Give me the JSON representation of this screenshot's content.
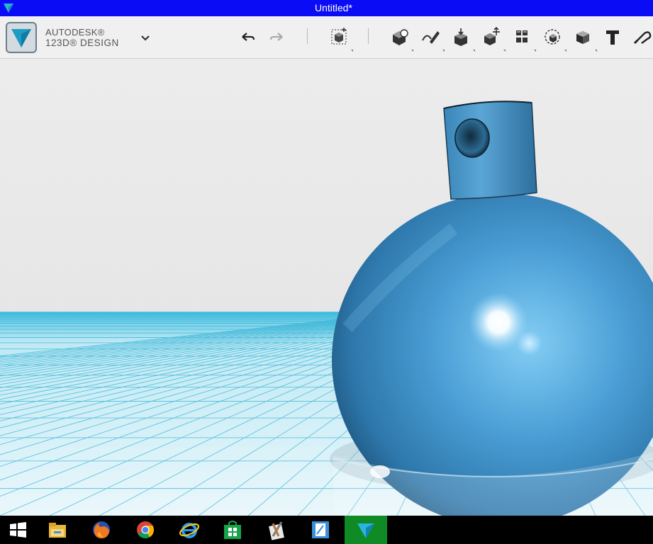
{
  "window": {
    "title": "Untitled*"
  },
  "app": {
    "brand_line1": "AUTODESK®",
    "brand_line2": "123D® DESIGN"
  },
  "toolbar": {
    "items": [
      {
        "icon": "undo-icon"
      },
      {
        "icon": "redo-icon"
      },
      {
        "icon": "primitives-icon"
      },
      {
        "icon": "sketch-icon"
      },
      {
        "icon": "construct-icon"
      },
      {
        "icon": "modify-icon"
      },
      {
        "icon": "pattern-icon"
      },
      {
        "icon": "group-icon"
      },
      {
        "icon": "combine-icon"
      },
      {
        "icon": "measure-icon"
      },
      {
        "icon": "text-icon"
      },
      {
        "icon": "snap-icon"
      }
    ]
  },
  "colors": {
    "titlebar": "#0a0cf5",
    "accent": "#1a9ba8",
    "model_blue": "#3e8fc7",
    "grid": "#39b4d6",
    "taskbar": "#000000",
    "active_task": "#0f8a24"
  },
  "taskbar": {
    "items": [
      {
        "icon": "windows-start-icon"
      },
      {
        "icon": "file-explorer-icon"
      },
      {
        "icon": "firefox-icon"
      },
      {
        "icon": "chrome-icon"
      },
      {
        "icon": "internet-explorer-icon"
      },
      {
        "icon": "windows-store-icon"
      },
      {
        "icon": "tools-app-icon"
      },
      {
        "icon": "notes-app-icon"
      },
      {
        "icon": "123d-design-icon"
      }
    ]
  }
}
